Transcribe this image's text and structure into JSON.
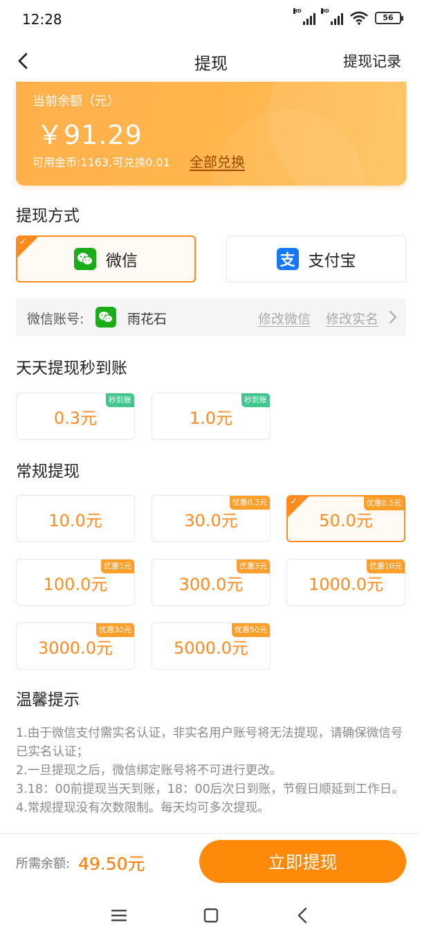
{
  "status": {
    "time": "12:28",
    "battery": "56"
  },
  "nav": {
    "title": "提现",
    "right": "提现记录"
  },
  "balance": {
    "label": "当前余额（元）",
    "amount": "￥91.29",
    "coins": "可用金币:1163,可兑换0.01",
    "exchange": "全部兑换"
  },
  "method_section": {
    "title": "提现方式",
    "methods": [
      {
        "label": "微信",
        "icon": "wechat-icon",
        "selected": true
      },
      {
        "label": "支付宝",
        "icon": "alipay-icon",
        "selected": false
      }
    ]
  },
  "account": {
    "label": "微信账号:",
    "name": "雨花石",
    "modify_wechat": "修改微信",
    "modify_name": "修改实名"
  },
  "daily_section": {
    "title": "天天提现秒到账",
    "items": [
      {
        "amount": "0.3元",
        "badge": "秒到账"
      },
      {
        "amount": "1.0元",
        "badge": "秒到账"
      }
    ]
  },
  "regular_section": {
    "title": "常规提现",
    "items": [
      {
        "amount": "10.0元",
        "badge": ""
      },
      {
        "amount": "30.0元",
        "badge": "优惠0.3元"
      },
      {
        "amount": "50.0元",
        "badge": "优惠0.5元",
        "selected": true
      },
      {
        "amount": "100.0元",
        "badge": "优惠1元"
      },
      {
        "amount": "300.0元",
        "badge": "优惠3元"
      },
      {
        "amount": "1000.0元",
        "badge": "优惠10元"
      },
      {
        "amount": "3000.0元",
        "badge": "优惠30元"
      },
      {
        "amount": "5000.0元",
        "badge": "优惠50元"
      }
    ]
  },
  "tips": {
    "title": "温馨提示",
    "lines": [
      "1.由于微信支付需实名认证，非实名用户账号将无法提现，请确保微信号已实名认证；",
      "2.一旦提现之后，微信绑定账号将不可进行更改。",
      "3.18：00前提现当天到账，18：00后次日到账，节假日顺延到工作日。",
      "4.常规提现没有次数限制。每天均可多次提现。"
    ]
  },
  "bottom": {
    "need_label": "所需余额:",
    "need_value": "49.50元",
    "submit": "立即提现"
  },
  "colors": {
    "accent": "#ff8a1e",
    "wechat": "#1aad19",
    "alipay": "#1677ff",
    "badge_green": "#3fc78d"
  }
}
